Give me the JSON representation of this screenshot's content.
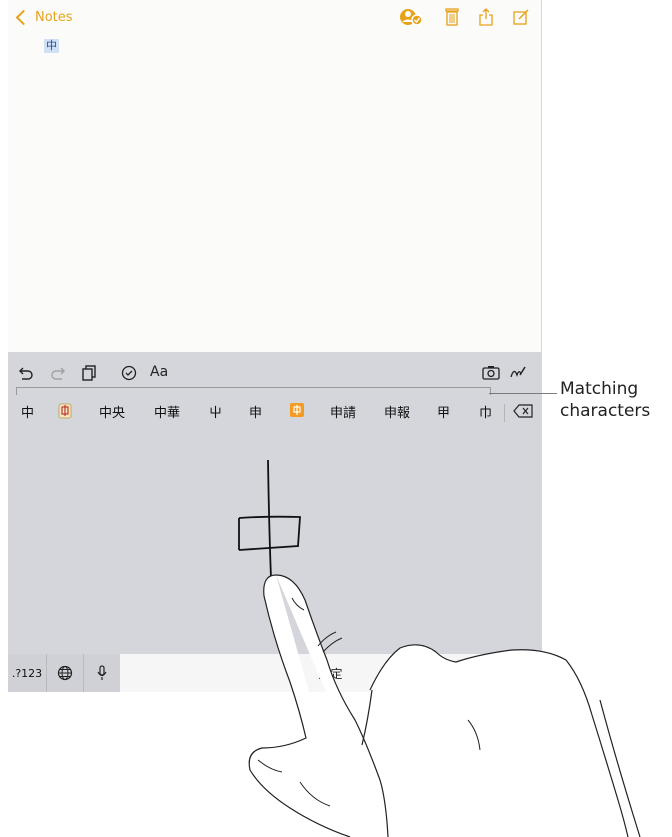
{
  "app": {
    "back_label": "Notes",
    "selected_text": "中"
  },
  "keyboard": {
    "candidates": [
      "中",
      "中央",
      "中華",
      "屮",
      "申",
      "申請",
      "申報",
      "甲",
      "巾"
    ],
    "space_label": "選定",
    "numbers_key": ".?123",
    "text_format_label": "Aa"
  },
  "callout": {
    "line1": "Matching",
    "line2": "characters"
  },
  "icons": {
    "accent_color": "#e7a21b",
    "toolbar": [
      "undo-icon",
      "redo-icon",
      "paste-icon",
      "checklist-icon",
      "camera-icon",
      "sketch-icon",
      "delete-key-icon"
    ],
    "top": [
      "add-people-icon",
      "trash-icon",
      "share-icon",
      "compose-icon"
    ]
  }
}
